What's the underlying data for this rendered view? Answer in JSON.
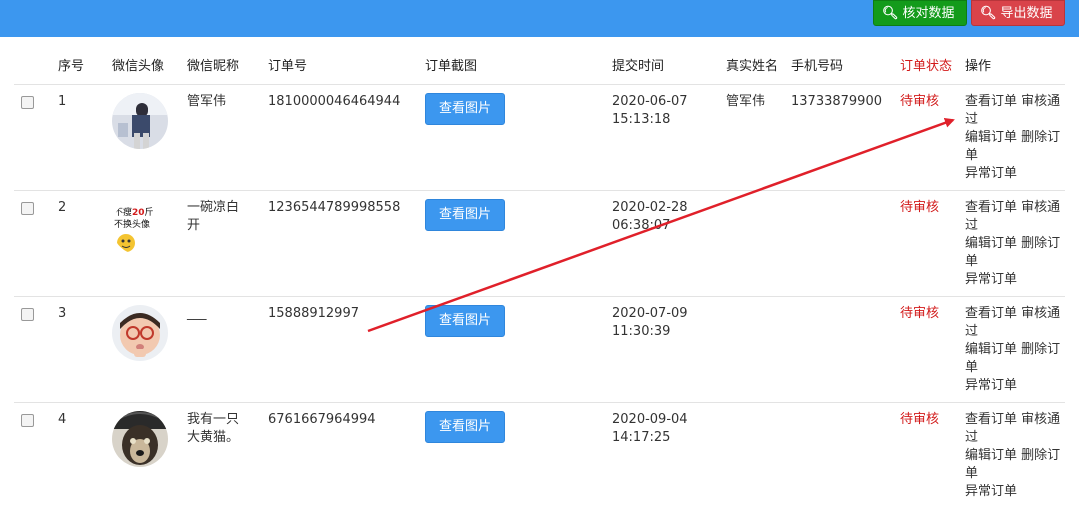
{
  "toolbar": {
    "check_label": "核对数据",
    "export_label": "导出数据",
    "check_color": "#139b1b",
    "export_color": "#d9434a"
  },
  "table": {
    "headers": [
      "序号",
      "微信头像",
      "微信昵称",
      "订单号",
      "订单截图",
      "提交时间",
      "真实姓名",
      "手机号码",
      "订单状态",
      "操作"
    ],
    "rows": [
      {
        "index": "1",
        "avatar_icon": "avatar-boy-photo",
        "nickname": "管军伟",
        "order_no": "1810000046464944",
        "view_label": "查看图片",
        "date": "2020-06-07",
        "time": "15:13:18",
        "real_name": "管军伟",
        "phone": "13733879900",
        "status": "待审核",
        "ops": {
          "view": "查看订单",
          "approve": "审核通过",
          "edit": "编辑订单",
          "delete": "删除订单",
          "abnormal": "异常订单"
        }
      },
      {
        "index": "2",
        "avatar_icon": "avatar-meme-sticker",
        "avatar_text": "不瘦20斤不换头像",
        "nickname": "一碗凉白开",
        "order_no": "1236544789998558",
        "view_label": "查看图片",
        "date": "2020-02-28",
        "time": "06:38:07",
        "real_name": "",
        "phone": "",
        "status": "待审核",
        "ops": {
          "view": "查看订单",
          "approve": "审核通过",
          "edit": "编辑订单",
          "delete": "删除订单",
          "abnormal": "异常订单"
        }
      },
      {
        "index": "3",
        "avatar_icon": "avatar-child-photo",
        "nickname": "___",
        "order_no": "15888912997",
        "view_label": "查看图片",
        "date": "2020-07-09",
        "time": "11:30:39",
        "real_name": "",
        "phone": "",
        "status": "待审核",
        "ops": {
          "view": "查看订单",
          "approve": "审核通过",
          "edit": "编辑订单",
          "delete": "删除订单",
          "abnormal": "异常订单"
        }
      },
      {
        "index": "4",
        "avatar_icon": "avatar-dog-photo",
        "nickname": "我有一只大黄猫。",
        "order_no": "6761667964994",
        "view_label": "查看图片",
        "date": "2020-09-04",
        "time": "14:17:25",
        "real_name": "",
        "phone": "",
        "status": "待审核",
        "ops": {
          "view": "查看订单",
          "approve": "审核通过",
          "edit": "编辑订单",
          "delete": "删除订单",
          "abnormal": "异常订单"
        }
      }
    ]
  },
  "colors": {
    "topbar": "#3c97ef",
    "status": "#d21a1a",
    "annotation_arrow": "#e0202a"
  }
}
